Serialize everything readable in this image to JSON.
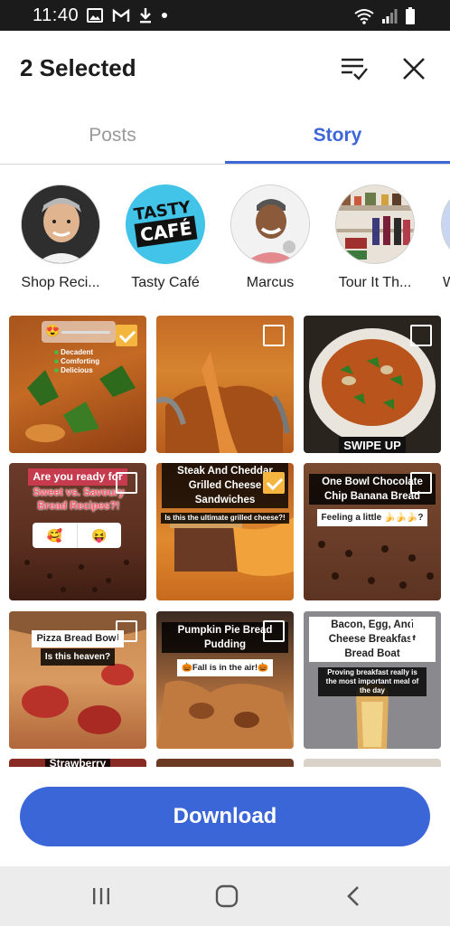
{
  "status_bar": {
    "time": "11:40",
    "left_icons": [
      "image-icon",
      "gmail-icon",
      "download-icon",
      "dot-icon"
    ],
    "right_icons": [
      "wifi-icon",
      "signal-icon",
      "battery-icon"
    ]
  },
  "header": {
    "title": "2 Selected",
    "select_all_icon": "select-all-icon",
    "close_icon": "close-icon"
  },
  "tabs": [
    {
      "label": "Posts",
      "active": false
    },
    {
      "label": "Story",
      "active": true
    }
  ],
  "creators": [
    {
      "name": "Shop Reci..."
    },
    {
      "name": "Tasty Café",
      "logo_line1": "TASTY",
      "logo_line2": "CAFÉ"
    },
    {
      "name": "Marcus"
    },
    {
      "name": "Tour It Th..."
    },
    {
      "name": "W"
    }
  ],
  "grid": {
    "tiles": [
      {
        "selected": true,
        "lines": [
          "Decadent",
          "Comforting",
          "Delicious"
        ],
        "sticker": "😍"
      },
      {
        "selected": false
      },
      {
        "selected": false,
        "caption": "SWIPE UP"
      },
      {
        "selected": false,
        "caption_top": "Are you ready for",
        "caption_main": "Sweet vs. Savoury Bread Recipes?!",
        "poll": [
          "🥰",
          "😝"
        ]
      },
      {
        "selected": true,
        "caption_main": "Steak And Cheddar Grilled Cheese Sandwiches",
        "caption_small": "Is this the ultimate grilled cheese?!"
      },
      {
        "selected": false,
        "caption_main": "One Bowl Chocolate Chip Banana Bread",
        "caption_sub": "Feeling a little 🍌🍌🍌?"
      },
      {
        "selected": false,
        "caption_main": "Pizza Bread Bowl",
        "caption_sub": "Is this heaven?"
      },
      {
        "selected": false,
        "caption_main": "Pumpkin Pie Bread Pudding",
        "caption_sub": "🎃Fall is in the air!🎃"
      },
      {
        "selected": false,
        "caption_main": "Bacon, Egg, And Cheese Breakfast Bread Boat",
        "caption_small": "Proving breakfast really is the most important meal of the day"
      },
      {
        "selected": false,
        "caption": "Strawberry"
      },
      {
        "selected": false
      },
      {
        "selected": false
      }
    ]
  },
  "download_label": "Download",
  "nav": {
    "recent_icon": "recent-apps-icon",
    "home_icon": "home-icon",
    "back_icon": "back-icon"
  },
  "colors": {
    "accent": "#3b66d8",
    "checkbox_selected": "#f4b63f",
    "status_bar": "#1b1b1b"
  }
}
